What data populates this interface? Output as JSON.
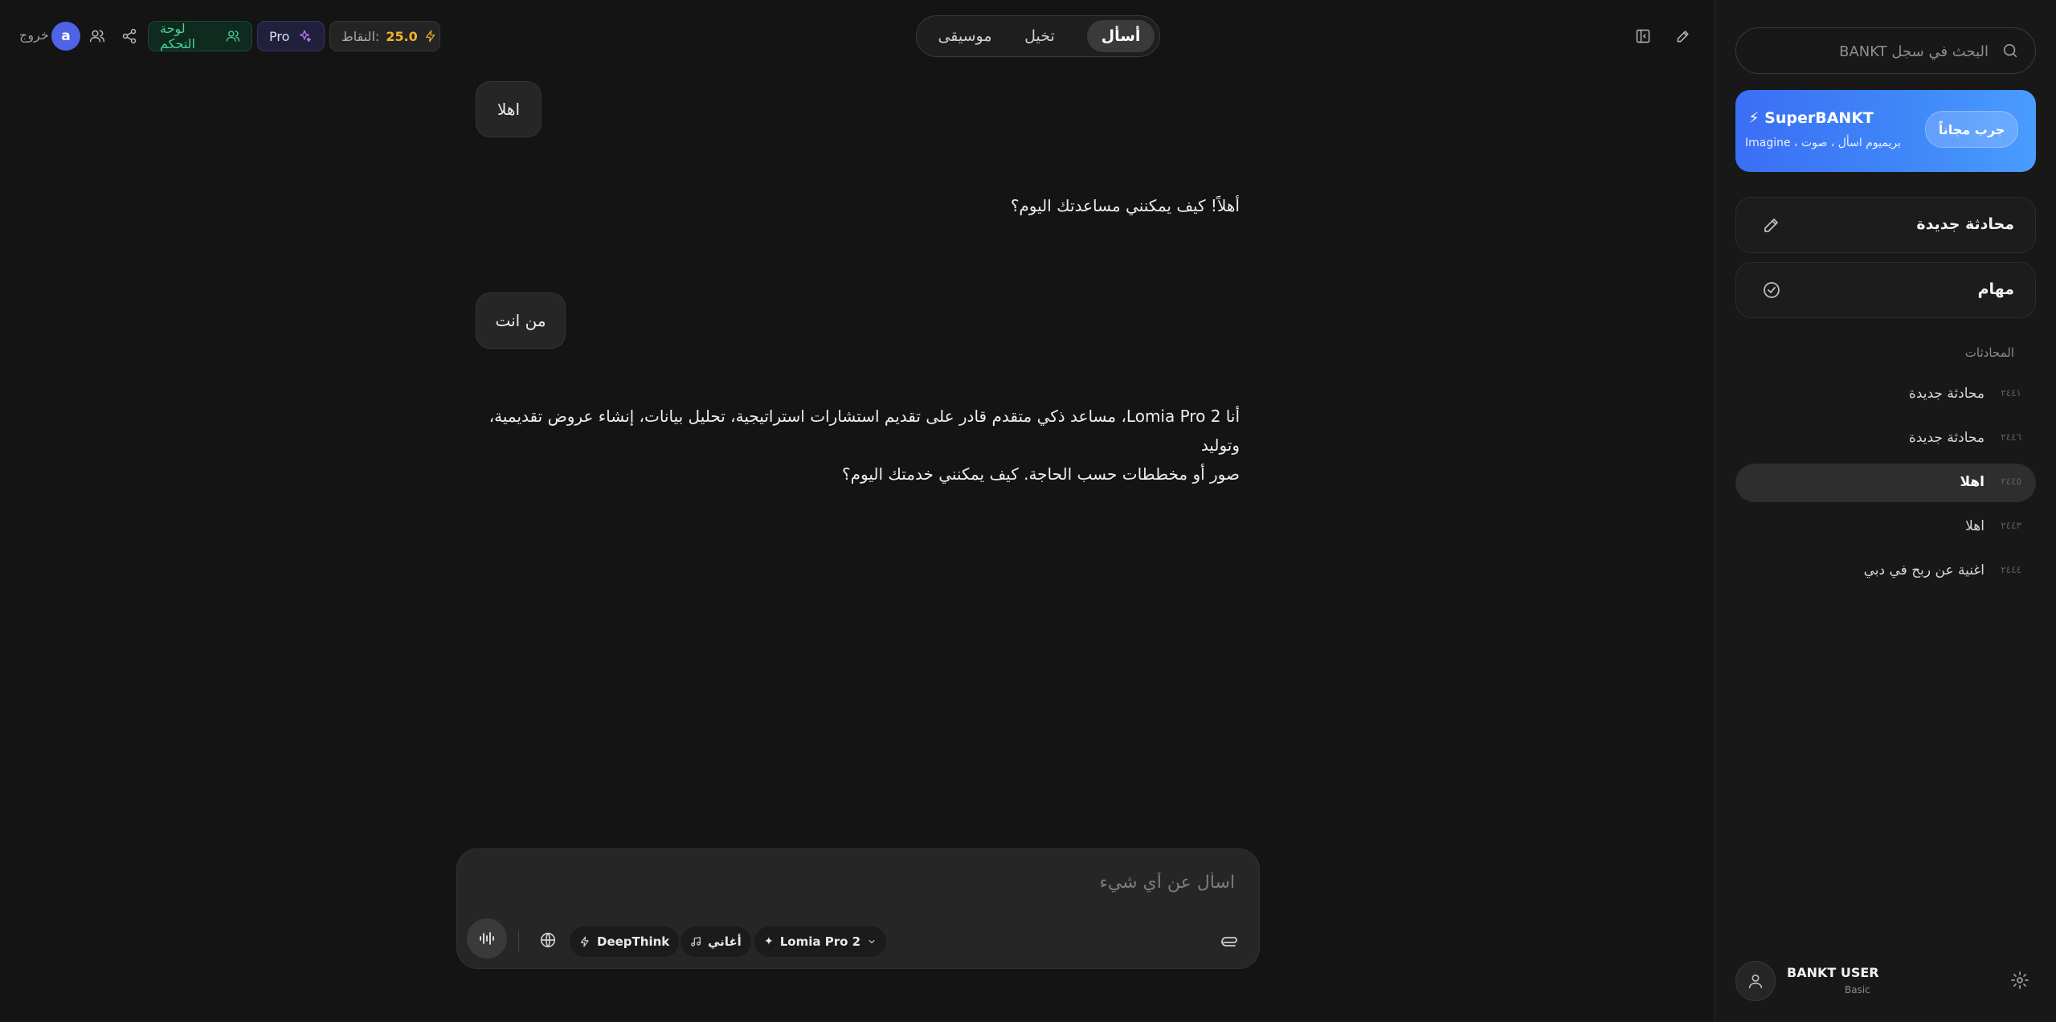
{
  "topbar": {
    "logout_label": "خروج",
    "avatar_letter": "a",
    "dashboard_label": "لوحة التحكم",
    "pro_label": "Pro",
    "points_label": "النقاط:",
    "points_value": "25.0",
    "modes": [
      {
        "label": "أسأل",
        "active": true
      },
      {
        "label": "تخيل",
        "active": false
      },
      {
        "label": "موسيقى",
        "active": false
      }
    ]
  },
  "chat": {
    "messages": [
      {
        "role": "user",
        "text": "اهلا"
      },
      {
        "role": "assistant",
        "text": "أهلاً! كيف يمكنني مساعدتك اليوم؟"
      },
      {
        "role": "user",
        "text": "من انت"
      },
      {
        "role": "assistant",
        "line1": "أنا Lomia Pro 2، مساعد ذكي متقدم قادر على تقديم استشارات استراتيجية، تحليل بيانات، إنشاء عروض تقديمية، وتوليد",
        "line2": "صور أو مخططات حسب الحاجة. كيف يمكنني خدمتك اليوم؟"
      }
    ]
  },
  "composer": {
    "placeholder": "اسأل عن أي شيء",
    "model_label": "Lomia Pro 2",
    "songs_label": "أغاني",
    "deepthink_label": "DeepThink"
  },
  "sidebar": {
    "search_placeholder": "البحث في سجل BANKT",
    "promo": {
      "title": "⚡ SuperBANKT",
      "subtitle": "بريميوم اسأل ، صوت ، Imagine",
      "button": "جرب مجاناً"
    },
    "new_chat_label": "محادثة جديدة",
    "tasks_label": "مهام",
    "section_label": "المحادثات",
    "conversations": [
      {
        "title": "محادثة جديدة",
        "meta": "٢٤٤١",
        "active": false
      },
      {
        "title": "محادثة جديدة",
        "meta": "٢٤٤٦",
        "active": false
      },
      {
        "title": "اهلا",
        "meta": "٢٤٤٥",
        "active": true
      },
      {
        "title": "اهلا",
        "meta": "٢٤٤٣",
        "active": false
      },
      {
        "title": "اغنية عن ربح في دبي",
        "meta": "٢٤٤٤",
        "active": false
      }
    ],
    "user": {
      "name": "BANKT USER",
      "plan": "Basic"
    }
  },
  "colors": {
    "background": "#141414",
    "sidebar": "#181818",
    "accent_blue": "#3b6ef5",
    "points": "#f0b429",
    "dashboard_green": "#46d39a"
  }
}
